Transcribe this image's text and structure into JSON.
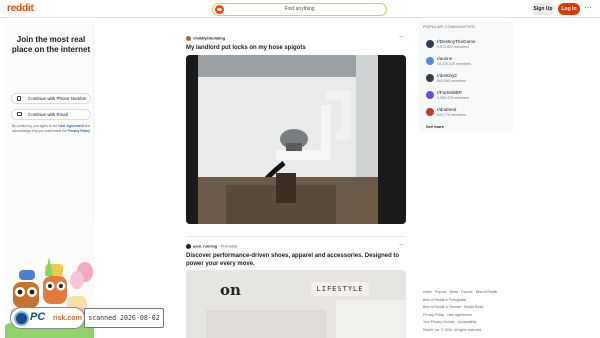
{
  "header": {
    "logo": "reddit",
    "search_placeholder": "Find anything",
    "signup": "Sign Up",
    "login": "Log In",
    "more": "···"
  },
  "left_panel": {
    "title": "Join the most real place on the internet",
    "phone_btn": "Continue with Phone Number",
    "email_btn": "Continue with Email",
    "terms_pre": "By continuing, you agree to our",
    "terms_link": "User Agreement",
    "terms_mid": "and acknowledge that you understand the",
    "privacy_link": "Privacy Policy"
  },
  "posts": [
    {
      "author": "r/mildlyinfuriating",
      "title": "My landlord put locks on my hose spigots",
      "more": "···"
    },
    {
      "author": "u/on_running",
      "tag": "Promoted",
      "title": "Discover performance-driven shoes, apparel and accessories. Designed to power your every move.",
      "image_text": "LIFESTYLE",
      "brand_mark": "on",
      "more": "···"
    }
  ],
  "right_panel": {
    "heading": "POPULAR COMMUNITIES",
    "communities": [
      {
        "name": "r/DestinyTheGame",
        "members": "3,572,801 members",
        "color": "#2c3e50"
      },
      {
        "name": "r/anime",
        "members": "14,370,225 members",
        "color": "#4a90d9"
      },
      {
        "name": "r/destiny2",
        "members": "963,590 members",
        "color": "#3d3d3d"
      },
      {
        "name": "r/FortniteBR",
        "members": "3,960,475 members",
        "color": "#6c4bd8"
      },
      {
        "name": "r/dndnext",
        "members": "824,770 members",
        "color": "#c0392b"
      }
    ],
    "see_more": "See more"
  },
  "footer": {
    "lines": [
      "Home · Popular · News · Explore · Best of Reddit",
      "Best of Reddit in Portuguese",
      "Best of Reddit in German · Reddit Rules",
      "Privacy Policy · User Agreement",
      "Your Privacy Choices · Accessibility",
      "Reddit, Inc. © 2026. All rights reserved."
    ]
  },
  "watermark": {
    "scanned": "scanned 2026-08-02",
    "pc": "PC",
    "risk": "risk.com"
  }
}
